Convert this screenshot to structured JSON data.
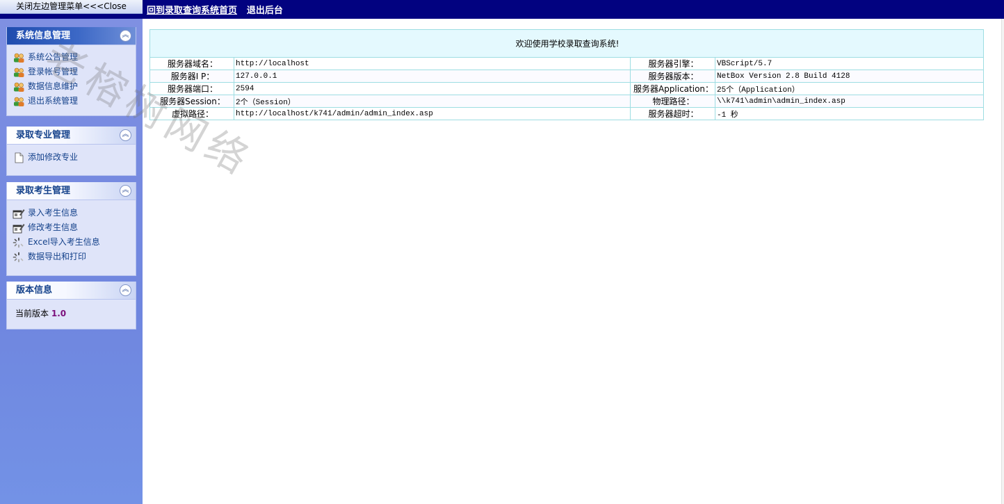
{
  "topbar": {
    "close_menu_label": "关闭左边管理菜单<<<Close",
    "nav": [
      {
        "label": "回到录取查询系统首页"
      },
      {
        "label": "退出后台"
      }
    ]
  },
  "sidebar": {
    "panels": [
      {
        "title": "系统信息管理",
        "items": [
          {
            "label": "系统公告管理",
            "icon": "users-icon"
          },
          {
            "label": "登录帐号管理",
            "icon": "users-icon"
          },
          {
            "label": "数据信息维护",
            "icon": "users-icon"
          },
          {
            "label": "退出系统管理",
            "icon": "users-icon"
          }
        ]
      },
      {
        "title": "录取专业管理",
        "items": [
          {
            "label": "添加修改专业",
            "icon": "document-icon"
          }
        ]
      },
      {
        "title": "录取考生管理",
        "items": [
          {
            "label": "录入考生信息",
            "icon": "window-edit-icon"
          },
          {
            "label": "修改考生信息",
            "icon": "window-edit-icon"
          },
          {
            "label": "Excel导入考生信息",
            "icon": "spinner-icon"
          },
          {
            "label": "数据导出和打印",
            "icon": "spinner-icon"
          }
        ]
      },
      {
        "title": "版本信息",
        "version_label": "当前版本",
        "version_number": "1.0"
      }
    ]
  },
  "main": {
    "welcome": "欢迎使用学校录取查询系统!",
    "rows": [
      {
        "label1": "服务器域名：",
        "value1": "http://localhost",
        "label2": "服务器引擎：",
        "value2": "VBScript/5.7"
      },
      {
        "label1": "服务器I  P：",
        "value1": "127.0.0.1",
        "label2": "服务器版本：",
        "value2": "NetBox Version 2.8 Build 4128"
      },
      {
        "label1": "服务器端口：",
        "value1": "2594",
        "label2": "服务器Application：",
        "value2": "25个（Application）"
      },
      {
        "label1": "服务器Session：",
        "value1": "2个（Session）",
        "label2": "物理路径：",
        "value2": "\\\\k741\\admin\\admin_index.asp"
      },
      {
        "label1": "虚拟路径：",
        "value1": "http://localhost/k741/admin/admin_index.asp",
        "label2": "服务器超时：",
        "value2": "-1 秒"
      }
    ]
  },
  "watermark": "老榕树网络",
  "colors": {
    "topbar": "#020280",
    "sidebar": "#7f90e2",
    "panel_title": "#15428b",
    "table_border": "#9ddde2",
    "welcome_bg": "#e4f9fe",
    "version_number": "#7b0f7b"
  }
}
